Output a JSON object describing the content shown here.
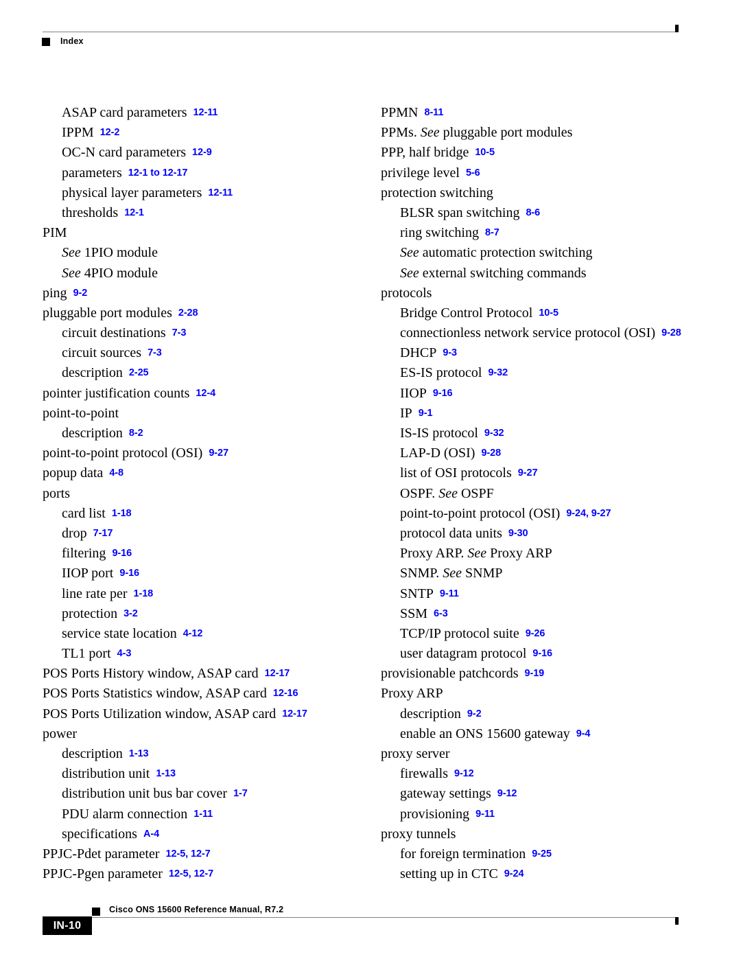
{
  "header": {
    "label": "Index",
    "marker_icon": "black-square-icon"
  },
  "footer": {
    "page_number": "IN-10",
    "document_title": "Cisco ONS 15600 Reference Manual, R7.2",
    "marker_icon": "black-square-icon"
  },
  "colors": {
    "page_reference": "#0000ff",
    "rule": "#808080",
    "marker": "#000000"
  },
  "columns": [
    {
      "id": "left",
      "entries": [
        {
          "level": 1,
          "term": "ASAP card parameters",
          "pages": "12-11"
        },
        {
          "level": 1,
          "term": "IPPM",
          "pages": "12-2"
        },
        {
          "level": 1,
          "term": "OC-N card parameters",
          "pages": "12-9"
        },
        {
          "level": 1,
          "term": "parameters",
          "pages": "12-1 to 12-17"
        },
        {
          "level": 1,
          "term": "physical layer parameters",
          "pages": "12-11"
        },
        {
          "level": 1,
          "term": "thresholds",
          "pages": "12-1"
        },
        {
          "level": 0,
          "term": "PIM",
          "pages": ""
        },
        {
          "level": 1,
          "see": "See",
          "term": "1PIO module",
          "pages": ""
        },
        {
          "level": 1,
          "see": "See",
          "term": "4PIO module",
          "pages": ""
        },
        {
          "level": 0,
          "term": "ping",
          "pages": "9-2"
        },
        {
          "level": 0,
          "term": "pluggable port modules",
          "pages": "2-28"
        },
        {
          "level": 1,
          "term": "circuit destinations",
          "pages": "7-3"
        },
        {
          "level": 1,
          "term": "circuit sources",
          "pages": "7-3"
        },
        {
          "level": 1,
          "term": "description",
          "pages": "2-25"
        },
        {
          "level": 0,
          "term": "pointer justification counts",
          "pages": "12-4"
        },
        {
          "level": 0,
          "term": "point-to-point",
          "pages": ""
        },
        {
          "level": 1,
          "term": "description",
          "pages": "8-2"
        },
        {
          "level": 0,
          "term": "point-to-point protocol (OSI)",
          "pages": "9-27"
        },
        {
          "level": 0,
          "term": "popup data",
          "pages": "4-8"
        },
        {
          "level": 0,
          "term": "ports",
          "pages": ""
        },
        {
          "level": 1,
          "term": "card list",
          "pages": "1-18"
        },
        {
          "level": 1,
          "term": "drop",
          "pages": "7-17"
        },
        {
          "level": 1,
          "term": "filtering",
          "pages": "9-16"
        },
        {
          "level": 1,
          "term": "IIOP port",
          "pages": "9-16"
        },
        {
          "level": 1,
          "term": "line rate per",
          "pages": "1-18"
        },
        {
          "level": 1,
          "term": "protection",
          "pages": "3-2"
        },
        {
          "level": 1,
          "term": "service state location",
          "pages": "4-12"
        },
        {
          "level": 1,
          "term": "TL1 port",
          "pages": "4-3"
        },
        {
          "level": 0,
          "term": "POS Ports History window, ASAP card",
          "pages": "12-17"
        },
        {
          "level": 0,
          "term": "POS Ports Statistics window, ASAP card",
          "pages": "12-16"
        },
        {
          "level": 0,
          "term": "POS Ports Utilization window, ASAP card",
          "pages": "12-17"
        },
        {
          "level": 0,
          "term": "power",
          "pages": ""
        },
        {
          "level": 1,
          "term": "description",
          "pages": "1-13"
        },
        {
          "level": 1,
          "term": "distribution unit",
          "pages": "1-13"
        },
        {
          "level": 1,
          "term": "distribution unit bus bar cover",
          "pages": "1-7"
        },
        {
          "level": 1,
          "term": "PDU alarm connection",
          "pages": "1-11"
        },
        {
          "level": 1,
          "term": "specifications",
          "pages": "A-4"
        },
        {
          "level": 0,
          "term": "PPJC-Pdet parameter",
          "pages": "12-5, 12-7"
        },
        {
          "level": 0,
          "term": "PPJC-Pgen parameter",
          "pages": "12-5, 12-7"
        }
      ]
    },
    {
      "id": "right",
      "entries": [
        {
          "level": 0,
          "term": "PPMN",
          "pages": "8-11"
        },
        {
          "level": 0,
          "prefix": "PPMs.",
          "see": "See",
          "term": "pluggable port modules",
          "pages": ""
        },
        {
          "level": 0,
          "term": "PPP, half bridge",
          "pages": "10-5"
        },
        {
          "level": 0,
          "term": "privilege level",
          "pages": "5-6"
        },
        {
          "level": 0,
          "term": "protection switching",
          "pages": ""
        },
        {
          "level": 1,
          "term": "BLSR span switching",
          "pages": "8-6"
        },
        {
          "level": 1,
          "term": "ring switching",
          "pages": "8-7"
        },
        {
          "level": 1,
          "see": "See",
          "term": "automatic protection switching",
          "pages": ""
        },
        {
          "level": 1,
          "see": "See",
          "term": "external switching commands",
          "pages": ""
        },
        {
          "level": 0,
          "term": "protocols",
          "pages": ""
        },
        {
          "level": 1,
          "term": "Bridge Control Protocol",
          "pages": "10-5"
        },
        {
          "level": 1,
          "term": "connectionless network service protocol (OSI)",
          "pages": "9-28"
        },
        {
          "level": 1,
          "term": "DHCP",
          "pages": "9-3"
        },
        {
          "level": 1,
          "term": "ES-IS protocol",
          "pages": "9-32"
        },
        {
          "level": 1,
          "term": "IIOP",
          "pages": "9-16"
        },
        {
          "level": 1,
          "term": "IP",
          "pages": "9-1"
        },
        {
          "level": 1,
          "term": "IS-IS protocol",
          "pages": "9-32"
        },
        {
          "level": 1,
          "term": "LAP-D (OSI)",
          "pages": "9-28"
        },
        {
          "level": 1,
          "term": "list of OSI protocols",
          "pages": "9-27"
        },
        {
          "level": 1,
          "prefix": "OSPF.",
          "see": "See",
          "term": "OSPF",
          "pages": ""
        },
        {
          "level": 1,
          "term": "point-to-point protocol (OSI)",
          "pages": "9-24, 9-27"
        },
        {
          "level": 1,
          "term": "protocol data units",
          "pages": "9-30"
        },
        {
          "level": 1,
          "prefix": "Proxy ARP.",
          "see": "See",
          "term": "Proxy ARP",
          "pages": ""
        },
        {
          "level": 1,
          "prefix": "SNMP.",
          "see": "See",
          "term": "SNMP",
          "pages": ""
        },
        {
          "level": 1,
          "term": "SNTP",
          "pages": "9-11"
        },
        {
          "level": 1,
          "term": "SSM",
          "pages": "6-3"
        },
        {
          "level": 1,
          "term": "TCP/IP protocol suite",
          "pages": "9-26"
        },
        {
          "level": 1,
          "term": "user datagram protocol",
          "pages": "9-16"
        },
        {
          "level": 0,
          "term": "provisionable patchcords",
          "pages": "9-19"
        },
        {
          "level": 0,
          "term": "Proxy ARP",
          "pages": ""
        },
        {
          "level": 1,
          "term": "description",
          "pages": "9-2"
        },
        {
          "level": 1,
          "term": "enable an ONS 15600 gateway",
          "pages": "9-4"
        },
        {
          "level": 0,
          "term": "proxy server",
          "pages": ""
        },
        {
          "level": 1,
          "term": "firewalls",
          "pages": "9-12"
        },
        {
          "level": 1,
          "term": "gateway settings",
          "pages": "9-12"
        },
        {
          "level": 1,
          "term": "provisioning",
          "pages": "9-11"
        },
        {
          "level": 0,
          "term": "proxy tunnels",
          "pages": ""
        },
        {
          "level": 1,
          "term": "for foreign termination",
          "pages": "9-25"
        },
        {
          "level": 1,
          "term": "setting up in CTC",
          "pages": "9-24"
        }
      ]
    }
  ]
}
